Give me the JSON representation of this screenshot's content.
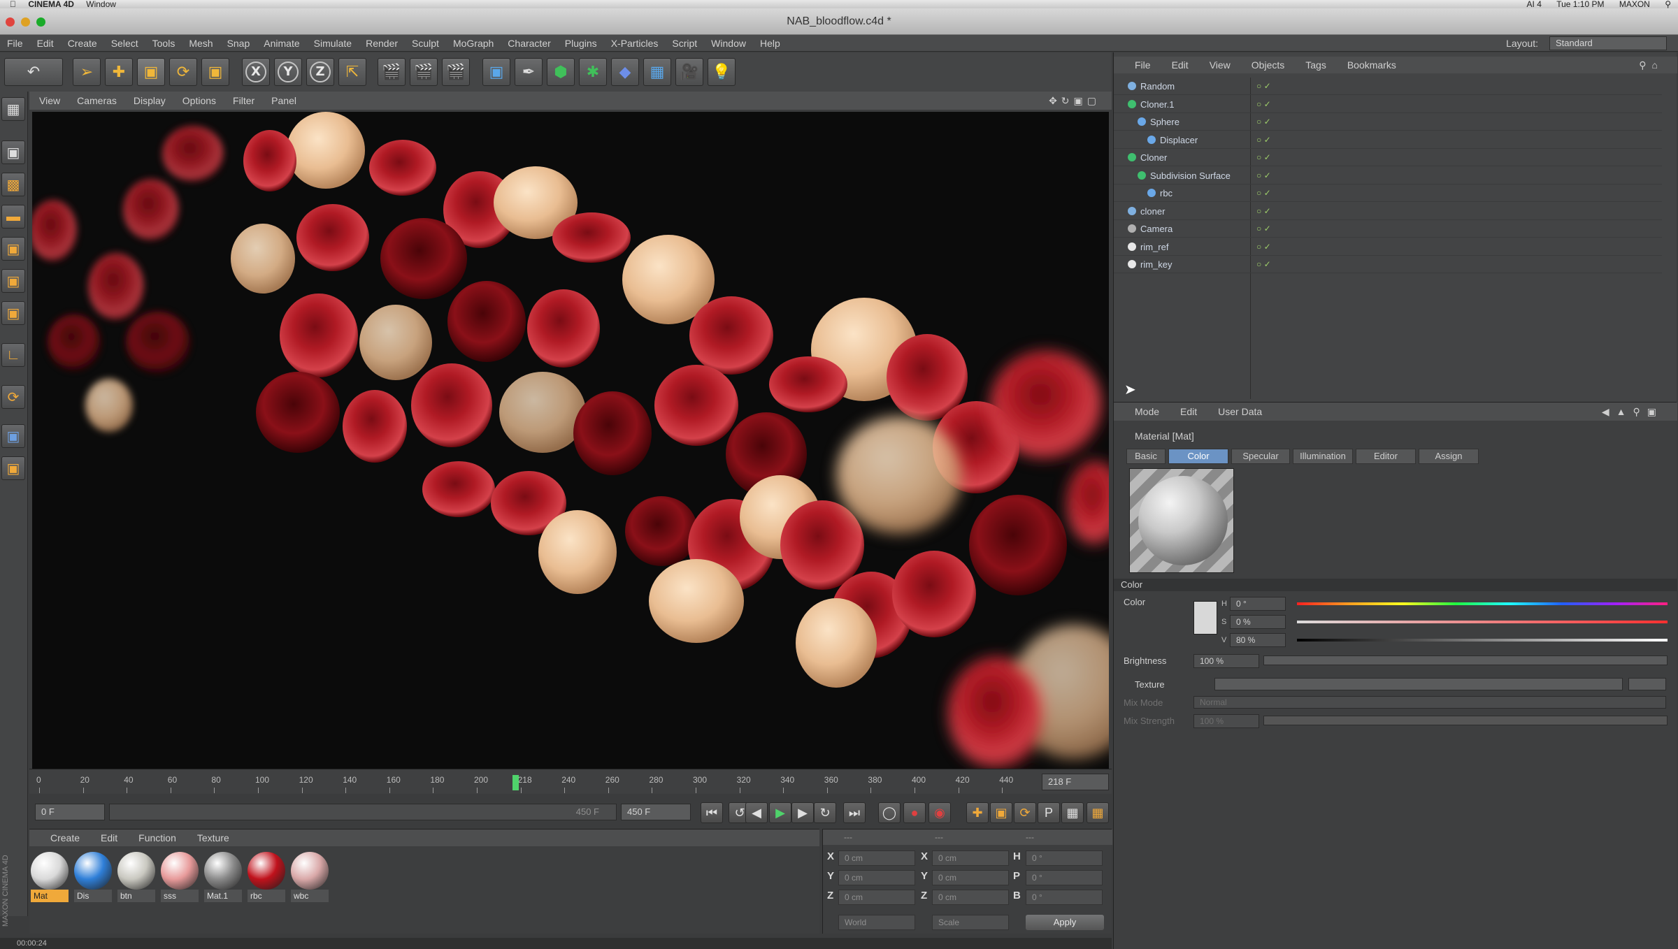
{
  "mac_menubar": {
    "app_name": "CINEMA 4D",
    "window_menu": "Window",
    "right_items": [
      "AI 4",
      "Tue 1:10 PM",
      "MAXON"
    ]
  },
  "window": {
    "title": "NAB_bloodflow.c4d *"
  },
  "menu": {
    "items": [
      "File",
      "Edit",
      "Create",
      "Select",
      "Tools",
      "Mesh",
      "Snap",
      "Animate",
      "Simulate",
      "Render",
      "Sculpt",
      "MoGraph",
      "Character",
      "Plugins",
      "X-Particles",
      "Script",
      "Window",
      "Help"
    ],
    "layout_label": "Layout:",
    "layout_value": "Standard"
  },
  "toolbar": {
    "axis_x": "X",
    "axis_y": "Y",
    "axis_z": "Z"
  },
  "viewport": {
    "menu": [
      "View",
      "Cameras",
      "Display",
      "Options",
      "Filter",
      "Panel"
    ]
  },
  "timeline": {
    "ticks": [
      "0",
      "20",
      "40",
      "60",
      "80",
      "100",
      "120",
      "140",
      "160",
      "180",
      "200",
      "218",
      "240",
      "260",
      "280",
      "300",
      "320",
      "340",
      "360",
      "380",
      "400",
      "420",
      "440"
    ],
    "current_frame": "218 F",
    "start_field": "0 F",
    "range_end": "450 F",
    "end_field": "450 F"
  },
  "material_manager": {
    "menu": [
      "Create",
      "Edit",
      "Function",
      "Texture"
    ],
    "materials": [
      {
        "label": "Mat",
        "color": "#d9d9d9"
      },
      {
        "label": "Dis",
        "color": "#2f7fd8"
      },
      {
        "label": "btn",
        "color": "#c9c8c0"
      },
      {
        "label": "sss",
        "color": "#e79a9a"
      },
      {
        "label": "Mat.1",
        "color": "#8a8a8a"
      },
      {
        "label": "rbc",
        "color": "#c0121c"
      },
      {
        "label": "wbc",
        "color": "#d9a8a8"
      }
    ],
    "vertical_label": "MAXON CINEMA 4D"
  },
  "coordinates": {
    "header": [
      "---",
      "---",
      "---"
    ],
    "rows": [
      {
        "label": "X",
        "pos": "0 cm",
        "label2": "X",
        "size": "0 cm",
        "label3": "H",
        "rot": "0 °"
      },
      {
        "label": "Y",
        "pos": "0 cm",
        "label2": "Y",
        "size": "0 cm",
        "label3": "P",
        "rot": "0 °"
      },
      {
        "label": "Z",
        "pos": "0 cm",
        "label2": "Z",
        "size": "0 cm",
        "label3": "B",
        "rot": "0 °"
      }
    ],
    "world_select": "World",
    "scale_select": "Scale",
    "apply": "Apply"
  },
  "status": {
    "time": "00:00:24"
  },
  "object_manager": {
    "menu": [
      "File",
      "Edit",
      "View",
      "Objects",
      "Tags",
      "Bookmarks"
    ],
    "objects": [
      {
        "name": "Random",
        "indent": 0,
        "icon": "#7fb0e0"
      },
      {
        "name": "Cloner.1",
        "indent": 0,
        "icon": "#3fbf6f"
      },
      {
        "name": "Sphere",
        "indent": 1,
        "icon": "#6aa8e8"
      },
      {
        "name": "Displacer",
        "indent": 2,
        "icon": "#6aa8e8"
      },
      {
        "name": "Cloner",
        "indent": 0,
        "icon": "#3fbf6f"
      },
      {
        "name": "Subdivision Surface",
        "indent": 1,
        "icon": "#3fbf6f"
      },
      {
        "name": "rbc",
        "indent": 2,
        "icon": "#6aa8e8"
      },
      {
        "name": "cloner",
        "indent": 0,
        "icon": "#7fb0e0"
      },
      {
        "name": "Camera",
        "indent": 0,
        "icon": "#b0b0b0"
      },
      {
        "name": "rim_ref",
        "indent": 0,
        "icon": "#e8e8e8"
      },
      {
        "name": "rim_key",
        "indent": 0,
        "icon": "#e8e8e8"
      }
    ]
  },
  "attribute_manager": {
    "menu": [
      "Mode",
      "Edit",
      "User Data"
    ],
    "title": "Material [Mat]",
    "tabs": [
      "Basic",
      "Color",
      "Specular",
      "Illumination",
      "Editor",
      "Assign"
    ],
    "active_tab": "Color",
    "section": "Color",
    "color_label": "Color",
    "h_label": "H",
    "h_value": "0 °",
    "s_label": "S",
    "s_value": "0 %",
    "v_label": "V",
    "v_value": "80 %",
    "brightness_label": "Brightness",
    "brightness_value": "100 %",
    "texture_label": "Texture",
    "mix_mode_label": "Mix Mode",
    "mix_mode_value": "Normal",
    "mix_strength_label": "Mix Strength",
    "mix_strength_value": "100 %"
  }
}
